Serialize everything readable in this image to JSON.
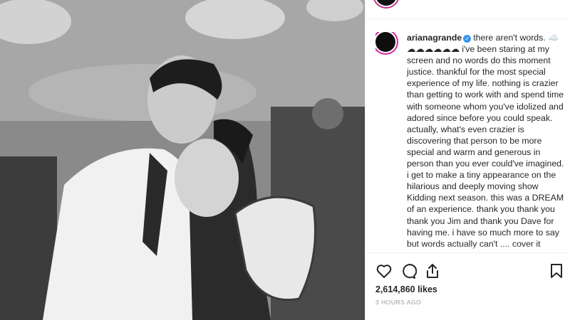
{
  "post": {
    "username": "arianagrande",
    "caption_head": "there aren't words. ☁️",
    "caption_body": "☁☁☁☁☁☁ i've been staring at my screen and no words do this moment justice. thankful for the most special experience of my life. nothing is crazier than getting to work with and spend time with someone whom you've idolized and adored since before you could speak. actually, what's even crazier is discovering that person to be more special and warm and generous in person than you ever could've imagined. i get to make a tiny appearance on the hilarious and deeply moving show Kidding next season. this was a DREAM of an experience. thank you thank you thank you Jim and thank you Dave for having me. i have so much more to say but words actually can't .... cover it",
    "likes": "2,614,860 likes",
    "timestamp": "3 HOURS AGO"
  },
  "icons": {
    "like": "heart-icon",
    "comment": "comment-icon",
    "share": "share-icon",
    "save": "bookmark-icon",
    "verified": "verified-badge"
  },
  "colors": {
    "verified": "#3897f0",
    "text": "#262626",
    "muted": "#999999"
  }
}
